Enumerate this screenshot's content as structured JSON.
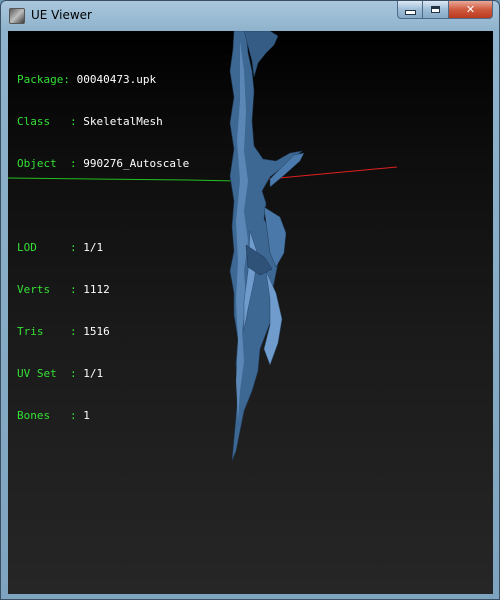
{
  "window": {
    "title": "UE Viewer",
    "icon": "ue-viewer-app-icon",
    "buttons": {
      "minimize": "minimize-icon",
      "maximize": "maximize-icon",
      "close": "close-icon"
    }
  },
  "info": {
    "rows_top": [
      {
        "label": "Package: ",
        "value": "00040473.upk"
      },
      {
        "label": "Class   : ",
        "value": "SkeletalMesh"
      },
      {
        "label": "Object  : ",
        "value": "990276_Autoscale"
      }
    ],
    "rows_bottom": [
      {
        "label": "LOD     : ",
        "value": "1/1"
      },
      {
        "label": "Verts   : ",
        "value": "1112"
      },
      {
        "label": "Tris    : ",
        "value": "1516"
      },
      {
        "label": "UV Set  : ",
        "value": "1/1"
      },
      {
        "label": "Bones   : ",
        "value": "1"
      }
    ]
  },
  "colors": {
    "label_green": "#35e035",
    "axis_x_red": "#e02020",
    "axis_y_green": "#20c020",
    "mesh_blue": "#3f6a96"
  }
}
